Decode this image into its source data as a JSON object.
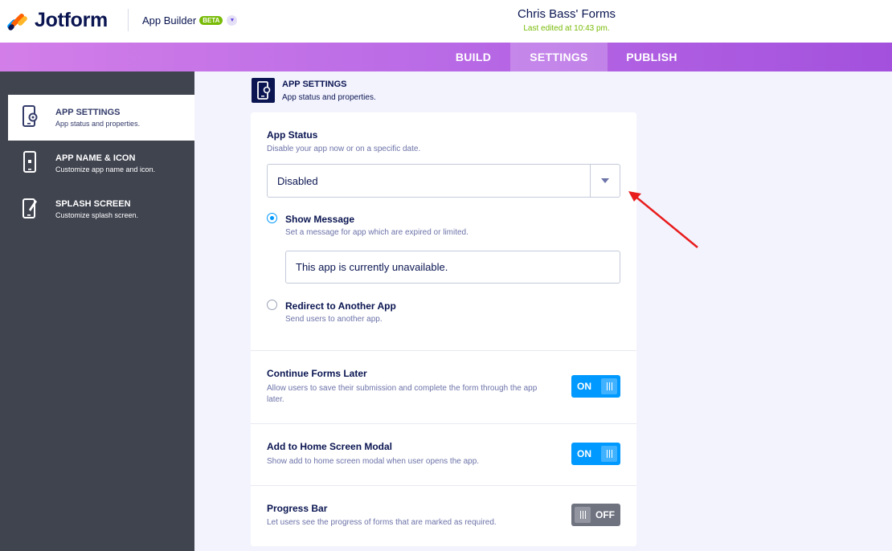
{
  "header": {
    "brand": "Jotform",
    "product": "App Builder",
    "badge": "BETA",
    "form_title": "Chris Bass' Forms",
    "last_edited": "Last edited at 10:43 pm."
  },
  "nav": {
    "tabs": [
      {
        "label": "BUILD"
      },
      {
        "label": "SETTINGS",
        "active": true
      },
      {
        "label": "PUBLISH"
      }
    ]
  },
  "sidebar": {
    "items": [
      {
        "title": "APP SETTINGS",
        "subtitle": "App status and properties.",
        "icon": "phone-gear-icon",
        "active": true
      },
      {
        "title": "APP NAME & ICON",
        "subtitle": "Customize app name and icon.",
        "icon": "phone-icon"
      },
      {
        "title": "SPLASH SCREEN",
        "subtitle": "Customize splash screen.",
        "icon": "phone-edit-icon"
      }
    ]
  },
  "main": {
    "heading": "APP SETTINGS",
    "subheading": "App status and properties."
  },
  "app_status": {
    "title": "App Status",
    "description": "Disable your app now or on a specific date.",
    "selected": "Disabled",
    "options": [
      {
        "label": "Show Message",
        "description": "Set a message for app which are expired or limited.",
        "checked": true
      },
      {
        "label": "Redirect to Another App",
        "description": "Send users to another app.",
        "checked": false
      }
    ],
    "message_value": "This app is currently unavailable."
  },
  "settings": [
    {
      "title": "Continue Forms Later",
      "description": "Allow users to save their submission and complete the form through the app later.",
      "state": "ON"
    },
    {
      "title": "Add to Home Screen Modal",
      "description": "Show add to home screen modal when user opens the app.",
      "state": "ON"
    },
    {
      "title": "Progress Bar",
      "description": "Let users see the progress of forms that are marked as required.",
      "state": "OFF"
    }
  ],
  "colors": {
    "accent": "#0099ff",
    "navy": "#0a1551",
    "sidebar": "#40444f",
    "annotation_arrow": "#e81c1c",
    "success": "#78bb07"
  }
}
